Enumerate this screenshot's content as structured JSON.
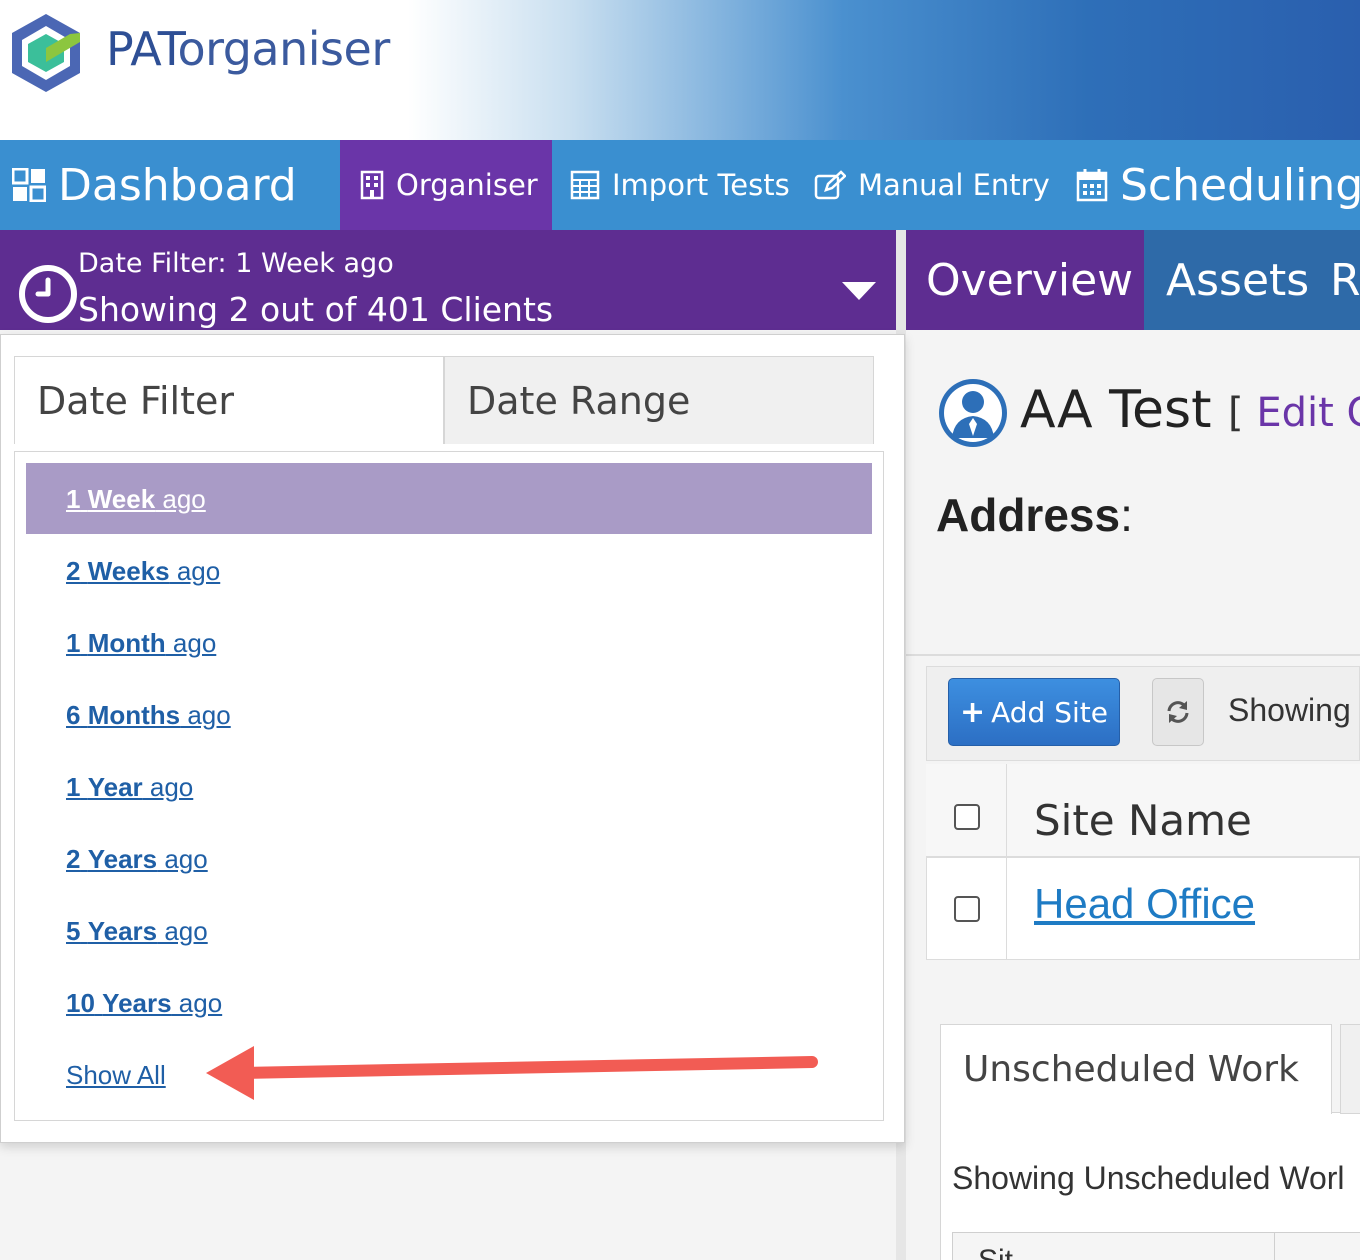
{
  "header": {
    "brand_pat": "PAT",
    "brand_rest": "organiser"
  },
  "main_nav": {
    "items": [
      {
        "label": "Dashboard",
        "icon": "dashboard-icon"
      },
      {
        "label": "Organiser",
        "icon": "building-icon",
        "active": true
      },
      {
        "label": "Import Tests",
        "icon": "calculator-icon"
      },
      {
        "label": "Manual Entry",
        "icon": "edit-icon"
      },
      {
        "label": "Scheduling",
        "icon": "calendar-icon"
      }
    ]
  },
  "filter_bar": {
    "line1": "Date Filter:  1 Week ago",
    "line2": "Showing 2 out of 401 Clients"
  },
  "sub_nav": {
    "items": [
      {
        "label": "Overview",
        "active": true
      },
      {
        "label": "Assets"
      },
      {
        "label": "Ri"
      }
    ]
  },
  "dropdown": {
    "tabs": [
      {
        "label": "Date Filter",
        "active": true
      },
      {
        "label": "Date Range"
      }
    ],
    "options": [
      {
        "num": "1",
        "unit": "Week",
        "suffix": " ago",
        "selected": true
      },
      {
        "num": "2",
        "unit": "Weeks",
        "suffix": " ago"
      },
      {
        "num": "1",
        "unit": "Month",
        "suffix": " ago"
      },
      {
        "num": "6",
        "unit": "Months",
        "suffix": " ago"
      },
      {
        "num": "1",
        "unit": "Year",
        "suffix": " ago"
      },
      {
        "num": "2",
        "unit": "Years",
        "suffix": " ago"
      },
      {
        "num": "5",
        "unit": "Years",
        "suffix": " ago"
      },
      {
        "num": "10",
        "unit": "Years",
        "suffix": " ago"
      }
    ],
    "show_all": "Show All"
  },
  "client": {
    "name": "AA Test",
    "edit_open": "[ ",
    "edit_label": "Edit C",
    "address_label": "Address",
    "address_colon": ":"
  },
  "sites": {
    "add_button": "Add Site",
    "showing": "Showing",
    "column_site_name": "Site Name",
    "rows": [
      {
        "name": "Head Office"
      }
    ]
  },
  "work": {
    "tab_label": "Unscheduled Work",
    "showing": "Showing Unscheduled Worl",
    "table_col1": "Sit"
  },
  "colors": {
    "nav_blue": "#3a8fd0",
    "purple": "#5e2d91",
    "selected_option": "#a99bc6",
    "link_blue": "#1f5fa6",
    "annotation_red": "#f25c54"
  }
}
